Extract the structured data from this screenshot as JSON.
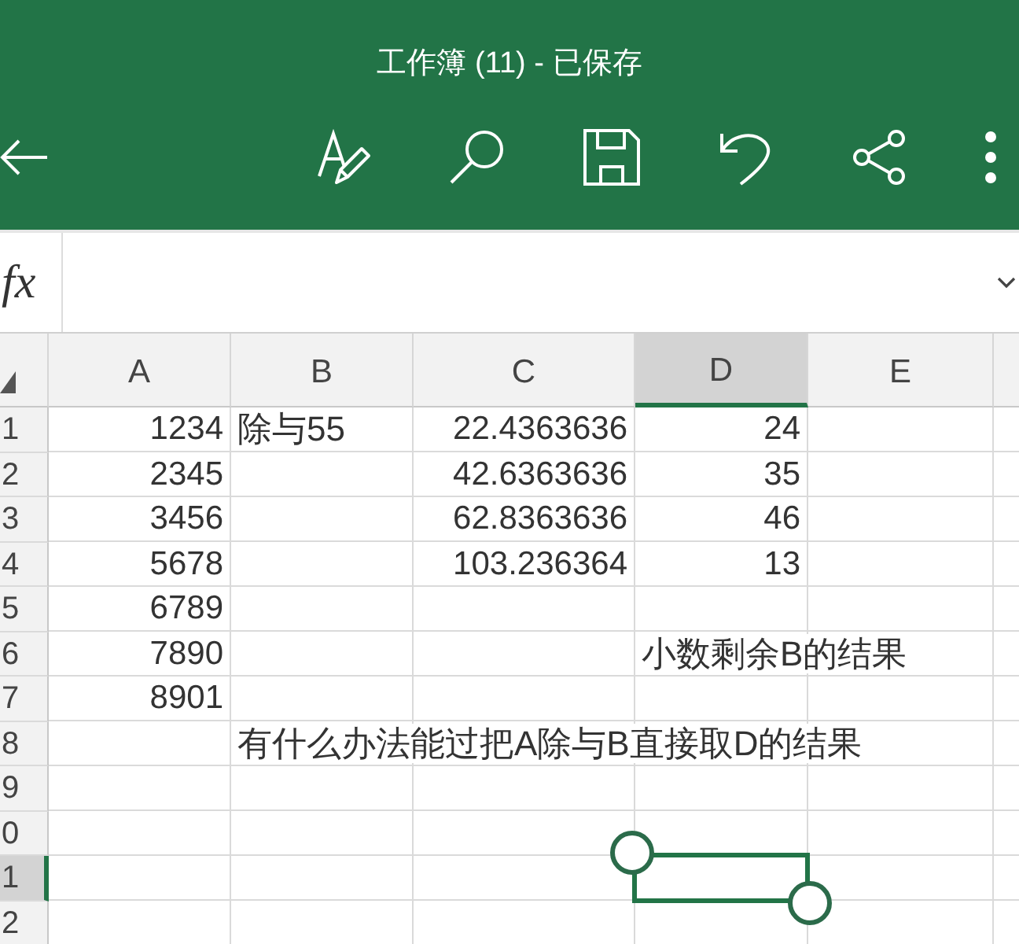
{
  "title_bar": {
    "title": "工作簿 (11) - 已保存"
  },
  "formula_bar": {
    "label": "fx"
  },
  "sheet": {
    "columns": [
      {
        "label": "A",
        "selected": false
      },
      {
        "label": "B",
        "selected": false
      },
      {
        "label": "C",
        "selected": false
      },
      {
        "label": "D",
        "selected": true
      },
      {
        "label": "E",
        "selected": false
      }
    ],
    "rows": [
      {
        "label": "1",
        "selected": false,
        "cells": [
          {
            "kind": "number",
            "text": "1234"
          },
          {
            "kind": "text",
            "text": "除与55"
          },
          {
            "kind": "number",
            "text": "22.4363636"
          },
          {
            "kind": "number",
            "text": "24"
          }
        ]
      },
      {
        "label": "2",
        "selected": false,
        "cells": [
          {
            "kind": "number",
            "text": "2345"
          },
          null,
          {
            "kind": "number",
            "text": "42.6363636"
          },
          {
            "kind": "number",
            "text": "35"
          }
        ]
      },
      {
        "label": "3",
        "selected": false,
        "cells": [
          {
            "kind": "number",
            "text": "3456"
          },
          null,
          {
            "kind": "number",
            "text": "62.8363636"
          },
          {
            "kind": "number",
            "text": "46"
          }
        ]
      },
      {
        "label": "4",
        "selected": false,
        "cells": [
          {
            "kind": "number",
            "text": "5678"
          },
          null,
          {
            "kind": "number",
            "text": "103.236364"
          },
          {
            "kind": "number",
            "text": "13"
          }
        ]
      },
      {
        "label": "5",
        "selected": false,
        "cells": [
          {
            "kind": "number",
            "text": "6789"
          }
        ]
      },
      {
        "label": "6",
        "selected": false,
        "cells": [
          {
            "kind": "number",
            "text": "7890"
          },
          null,
          null,
          {
            "kind": "text",
            "text": "小数剩余B的结果"
          }
        ]
      },
      {
        "label": "7",
        "selected": false,
        "cells": [
          {
            "kind": "number",
            "text": "8901"
          }
        ]
      },
      {
        "label": "8",
        "selected": false,
        "cells": [
          null,
          {
            "kind": "text",
            "text": "有什么办法能过把A除与B直接取D的结果"
          }
        ]
      },
      {
        "label": "9",
        "selected": false
      },
      {
        "label": "0",
        "selected": false
      },
      {
        "label": "1",
        "selected": true
      },
      {
        "label": "2",
        "selected": false
      }
    ]
  }
}
